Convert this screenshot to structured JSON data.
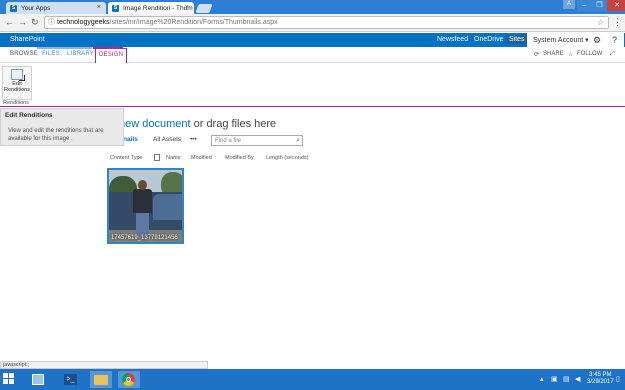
{
  "browser": {
    "tabs": [
      {
        "title": "Your Apps"
      },
      {
        "title": "Image Rendition - Thum"
      }
    ],
    "url_host": "technologygeeks",
    "url_path": "/sites/mr/Image%20Rendition/Forms/Thumbnails.aspx",
    "user_badge": "A"
  },
  "suitebar": {
    "brand": "SharePoint",
    "links": [
      "Newsfeed",
      "OneDrive",
      "Sites"
    ],
    "account": "System Account ▾"
  },
  "ribbon": {
    "tabs": [
      "BROWSE",
      "FILES",
      "LIBRARY",
      "DESIGN"
    ],
    "share": "SHARE",
    "follow": "FOLLOW",
    "edit_renditions_line1": "Edit",
    "edit_renditions_line2": "Renditions",
    "group_label": "Renditions"
  },
  "tooltip": {
    "title": "Edit Renditions",
    "body": "View and edit the renditions that are available for this image ."
  },
  "main": {
    "new_document": "new document",
    "drag_text": " or drag files here",
    "views": [
      "Thumbnails",
      "All Assets",
      "•••"
    ],
    "views_visible": [
      "bnails",
      "All Assets",
      "•••"
    ],
    "search_placeholder": "Find a file",
    "columns": [
      "Content Type",
      "Name",
      "Modified",
      "Modified By",
      "Length (seconds)"
    ],
    "thumbnail_caption": "17457619_13779121456"
  },
  "statusbar": {
    "text": "javascript:;"
  },
  "taskbar": {
    "time": "3:45 PM",
    "date": "3/29/2017"
  }
}
